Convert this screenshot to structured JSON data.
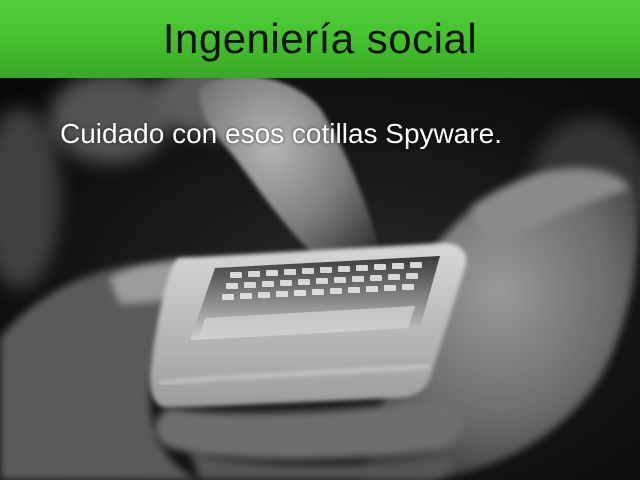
{
  "slide": {
    "title": "Ingeniería social",
    "subtitle": "Cuidado con esos cotillas Spyware.",
    "title_bar_color": "#46c32f",
    "title_text_color": "#111111",
    "subtitle_color": "#ffffff",
    "photo_icon": "hand-holding-phone-photo"
  }
}
